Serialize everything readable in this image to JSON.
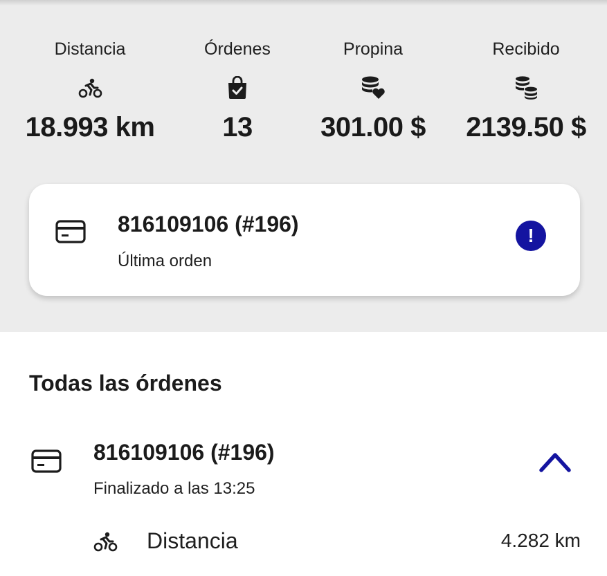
{
  "summary": {
    "distance": {
      "label": "Distancia",
      "value": "18.993 km",
      "icon": "bicycle-rider-icon"
    },
    "orders": {
      "label": "Órdenes",
      "value": "13",
      "icon": "shopping-bag-check-icon"
    },
    "tip": {
      "label": "Propina",
      "value": "301.00 $",
      "icon": "coins-heart-icon"
    },
    "received": {
      "label": "Recibido",
      "value": "2139.50 $",
      "icon": "coin-stack-icon"
    }
  },
  "last_order": {
    "title": "816109106 (#196)",
    "subtitle": "Última orden",
    "icon": "credit-card-icon",
    "alert_icon": "exclamation-circle-icon",
    "alert_symbol": "!"
  },
  "all_orders": {
    "heading": "Todas las órdenes",
    "items": [
      {
        "title": "816109106 (#196)",
        "subtitle": "Finalizado a las 13:25",
        "icon": "credit-card-icon",
        "toggle_icon": "chevron-up-icon",
        "details": [
          {
            "label": "Distancia",
            "value": "4.282 km",
            "icon": "bicycle-rider-icon"
          }
        ]
      }
    ]
  },
  "colors": {
    "summary_background": "#ececec",
    "accent": "#1414a0",
    "text": "#1b1b1b"
  }
}
